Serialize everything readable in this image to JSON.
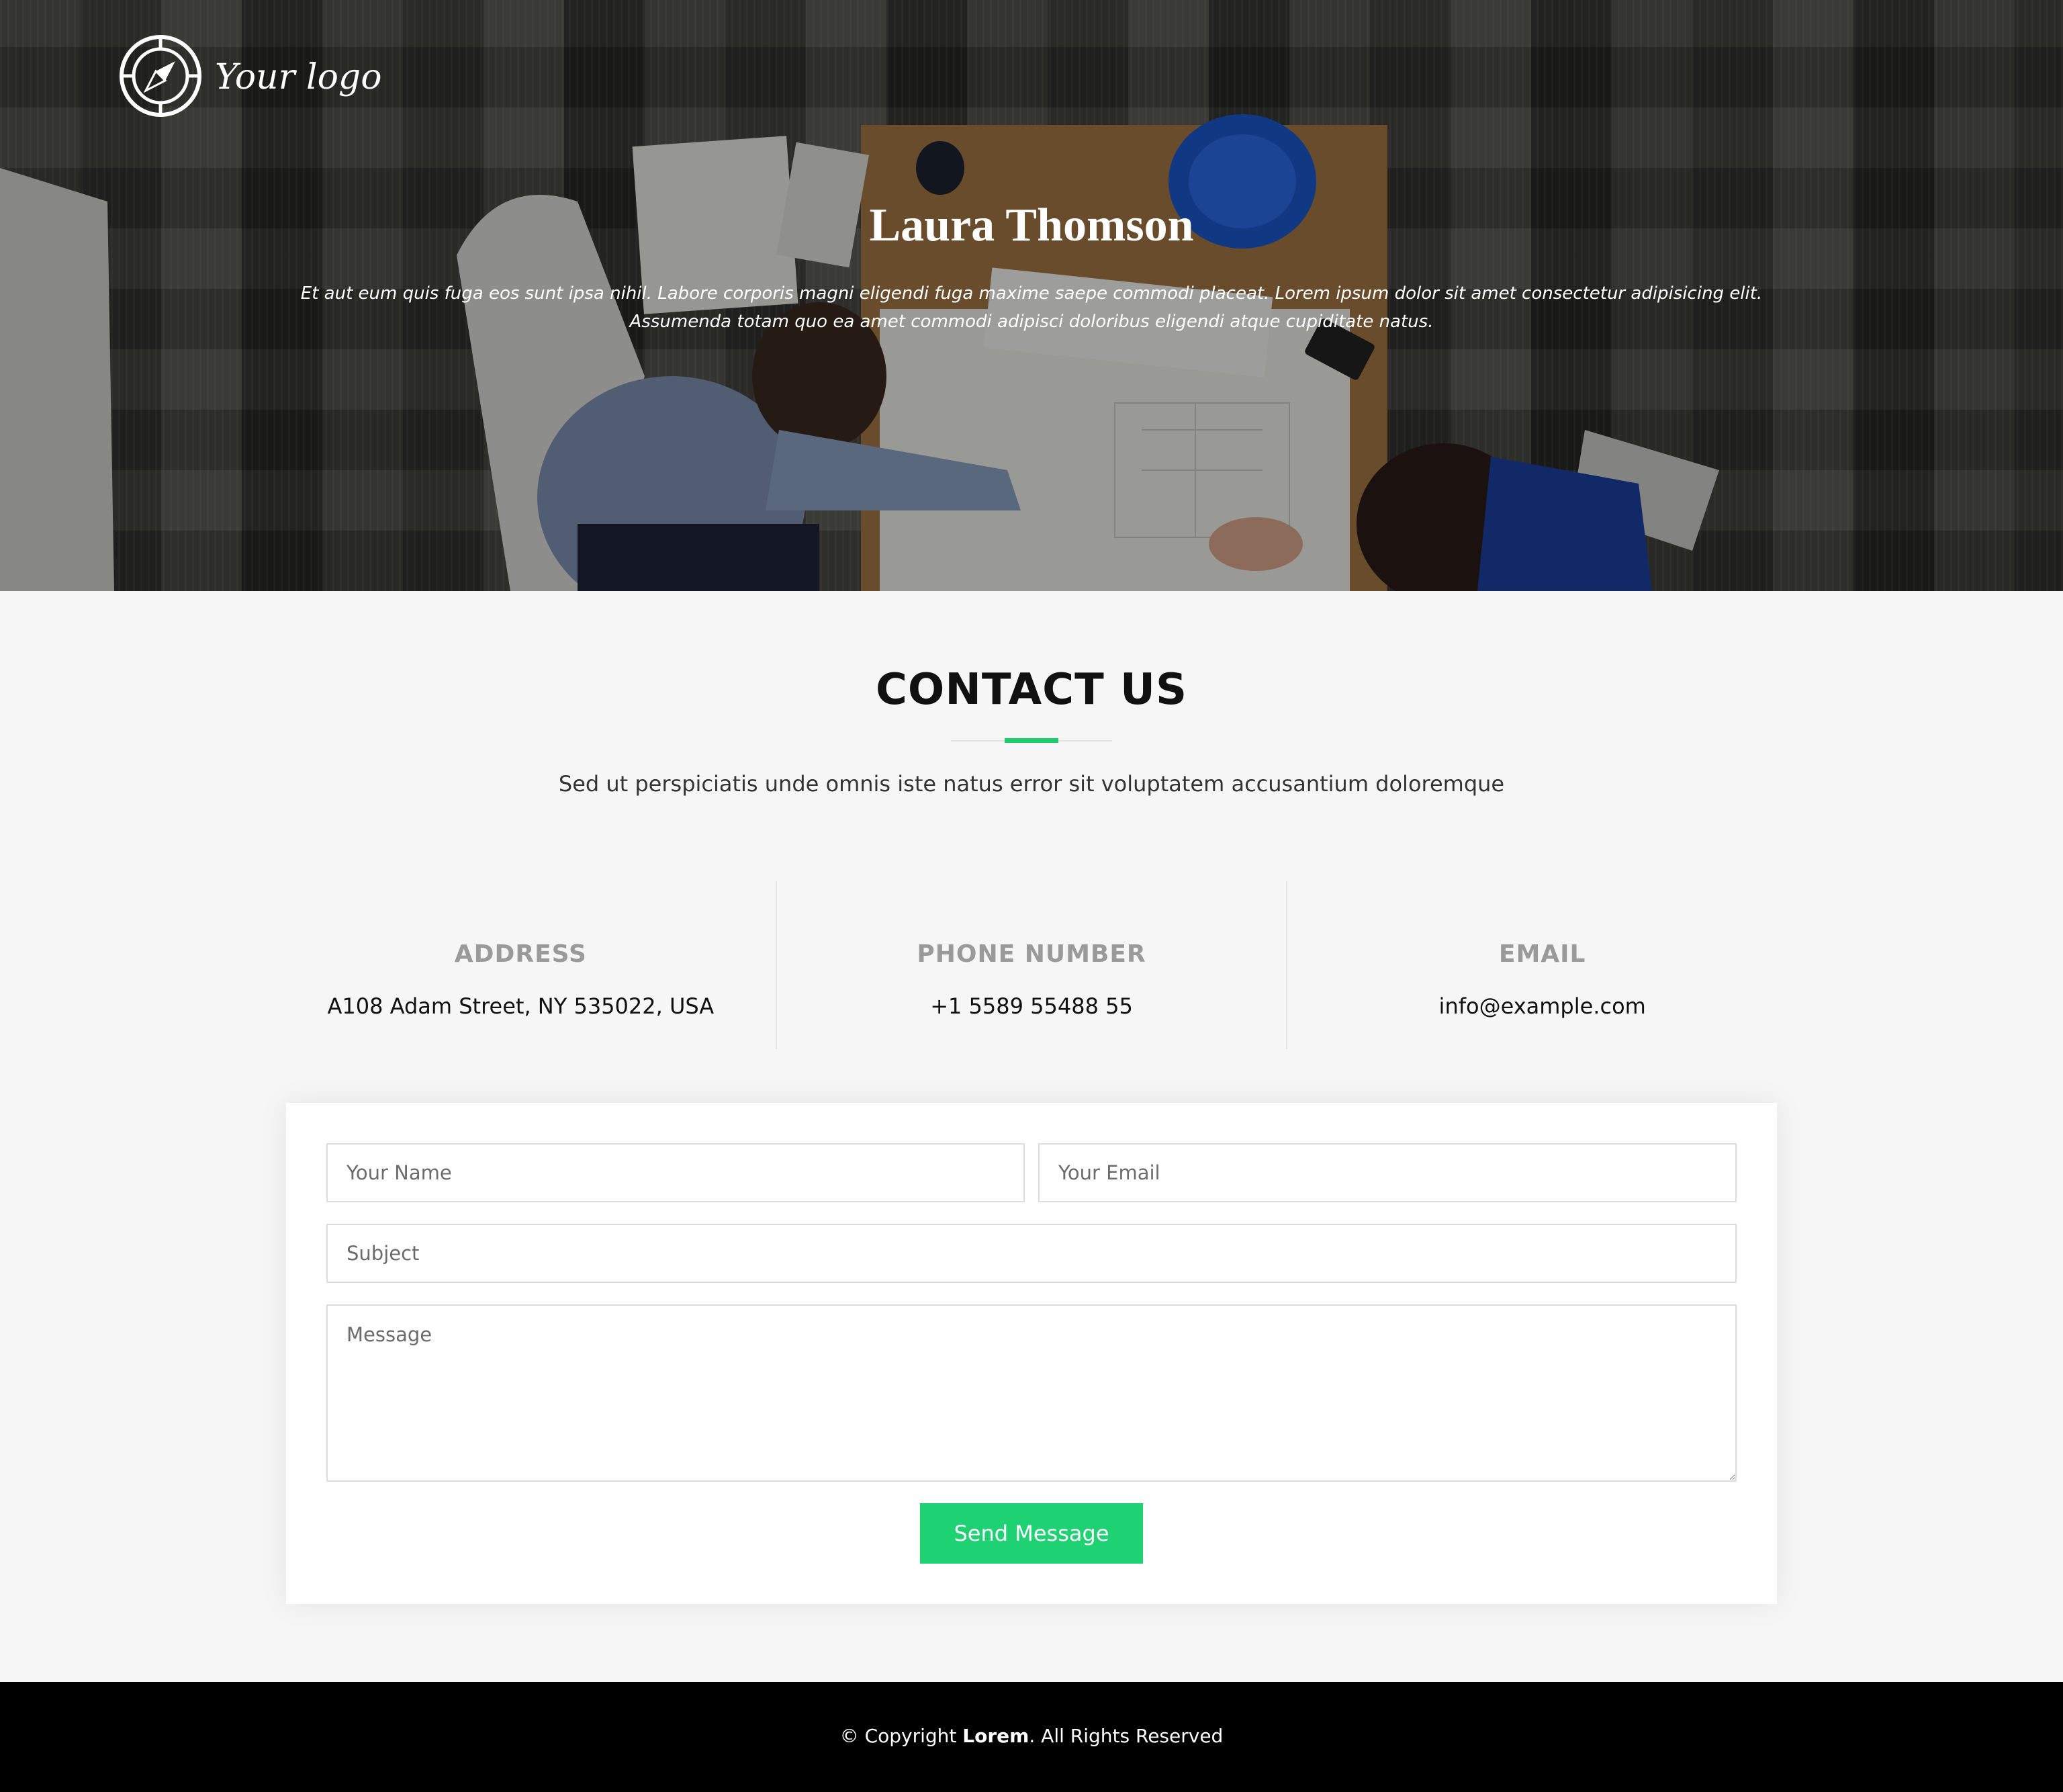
{
  "header": {
    "logo_text": "Your logo",
    "logo_icon": "compass-icon"
  },
  "hero": {
    "title": "Laura Thomson",
    "text": "Et aut eum quis fuga eos sunt ipsa nihil. Labore corporis magni eligendi fuga maxime saepe commodi placeat. Lorem ipsum dolor sit amet consectetur adipisicing elit. Assumenda totam quo ea amet commodi adipisci doloribus eligendi atque cupiditate natus."
  },
  "contact": {
    "title": "CONTACT US",
    "subtitle": "Sed ut perspiciatis unde omnis iste natus error sit voluptatem accusantium doloremque",
    "accent_color": "#1ecf6f",
    "info": [
      {
        "label": "ADDRESS",
        "value": "A108 Adam Street, NY 535022, USA"
      },
      {
        "label": "PHONE NUMBER",
        "value": "+1 5589 55488 55"
      },
      {
        "label": "EMAIL",
        "value": "info@example.com"
      }
    ],
    "form": {
      "name_placeholder": "Your Name",
      "email_placeholder": "Your Email",
      "subject_placeholder": "Subject",
      "message_placeholder": "Message",
      "send_label": "Send Message",
      "button_color": "#1ed172"
    }
  },
  "footer": {
    "prefix": "© Copyright ",
    "brand": "Lorem",
    "suffix": ". All Rights Reserved"
  }
}
